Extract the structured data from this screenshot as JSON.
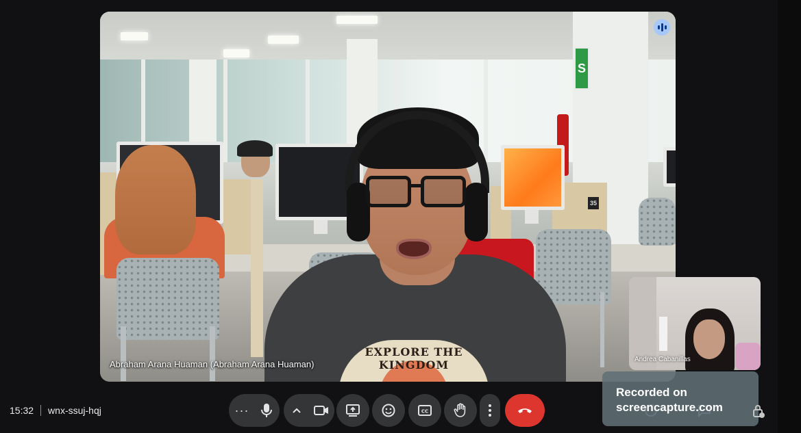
{
  "meeting": {
    "time": "15:32",
    "code": "wnx-ssuj-hqj"
  },
  "main_participant": {
    "name_label": "Abraham Arana Huaman (Abraham Arana Huaman)",
    "shirt_text": "EXPLORE THE KINGDOM",
    "speaking_indicator": "audio-level-icon"
  },
  "scene": {
    "desk_number": "35",
    "sign_symbol": "S"
  },
  "self_view": {
    "name_label": "Andrea Cabanillas"
  },
  "controls": [
    {
      "name": "more-options-left",
      "icon": "more-horizontal-icon"
    },
    {
      "name": "microphone",
      "icon": "mic-icon"
    },
    {
      "name": "video-options",
      "icon": "chevron-up-icon"
    },
    {
      "name": "camera",
      "icon": "videocam-icon"
    },
    {
      "name": "present-screen",
      "icon": "present-icon"
    },
    {
      "name": "reactions",
      "icon": "emoji-icon"
    },
    {
      "name": "captions",
      "icon": "captions-icon"
    },
    {
      "name": "raise-hand",
      "icon": "hand-icon"
    },
    {
      "name": "more-options",
      "icon": "more-vertical-icon"
    },
    {
      "name": "leave-call",
      "icon": "call-end-icon"
    }
  ],
  "watermark": {
    "line1": "Recorded on",
    "line2": "screencapture.com"
  },
  "colors": {
    "background": "#111113",
    "control": "#333537",
    "hangup": "#dc362e",
    "speaking": "#a8c7fa"
  }
}
